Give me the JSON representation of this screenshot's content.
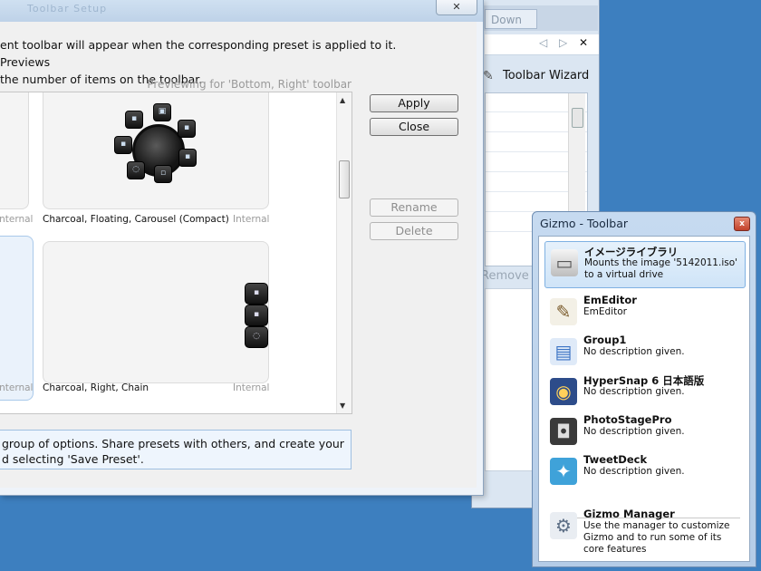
{
  "background_window": {
    "down_label": "Down",
    "nav": {
      "prev": "◁",
      "next": "▷",
      "close": "✕"
    },
    "wizard_icon": "wand-icon",
    "wizard_label": "Toolbar Wizard",
    "remove_label": "Remove"
  },
  "dialog": {
    "title_faint": "Toolbar Setup",
    "close_glyph": "✕",
    "description": "ent toolbar will appear when the corresponding preset is applied to it. Previews\nthe number of items on the toolbar.",
    "previewing": "Previewing for 'Bottom, Right' toolbar",
    "presets": [
      {
        "tag": "Internal"
      },
      {
        "label": "Charcoal, Floating, Carousel (Compact)",
        "tag": "Internal"
      },
      {
        "tag": "Internal"
      },
      {
        "label": "Charcoal, Right, Chain",
        "tag": "Internal"
      }
    ],
    "buttons": {
      "apply": "Apply",
      "close": "Close",
      "rename": "Rename",
      "delete": "Delete"
    },
    "tip": "group of options. Share presets with others, and create your\nd selecting 'Save Preset'."
  },
  "gizmo": {
    "title": "Gizmo - Toolbar",
    "close_glyph": "x",
    "items": [
      {
        "name": "イメージライブラリ",
        "desc": "Mounts the image '5142011.iso' to a virtual drive",
        "icon": "drive-icon",
        "glyph": "▭"
      },
      {
        "name": "EmEditor",
        "desc": "EmEditor",
        "icon": "editor-icon",
        "glyph": "✎"
      },
      {
        "name": "Group1",
        "desc": "No description given.",
        "icon": "folder-icon",
        "glyph": "▤"
      },
      {
        "name": "HyperSnap 6 日本語版",
        "desc": "No description given.",
        "icon": "hypersnap-icon",
        "glyph": "◉"
      },
      {
        "name": "PhotoStagePro",
        "desc": "No description given.",
        "icon": "camera-icon",
        "glyph": "◘"
      },
      {
        "name": "TweetDeck",
        "desc": "No description given.",
        "icon": "tweetdeck-icon",
        "glyph": "✦"
      },
      {
        "name": "Gizmo Manager",
        "desc": "Use the manager to customize Gizmo and to run some of its core features",
        "icon": "gizmo-manager-icon",
        "glyph": "⚙"
      }
    ]
  }
}
